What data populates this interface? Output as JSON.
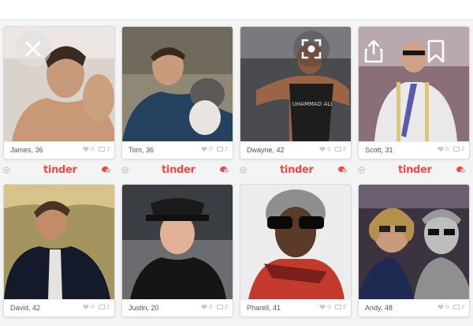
{
  "colors": {
    "brand": "#ee4a44",
    "muted": "#b5b5b5",
    "text": "#555555"
  },
  "brand_label": "tinder",
  "overlay_icons": [
    "close-icon",
    "scan-icon",
    "share-icon",
    "bookmark-icon"
  ],
  "row1": [
    {
      "name": "James, 36",
      "likes": "0",
      "photos": "2"
    },
    {
      "name": "Tom, 36",
      "likes": "0",
      "photos": "2"
    },
    {
      "name": "Dwayne, 42",
      "likes": "0",
      "photos": "2"
    },
    {
      "name": "Scott, 31",
      "likes": "0",
      "photos": "2"
    }
  ],
  "row2": [
    {
      "name": "David, 42",
      "likes": "0",
      "photos": "2"
    },
    {
      "name": "Justin, 20",
      "likes": "0",
      "photos": "2"
    },
    {
      "name": "Pharell, 41",
      "likes": "0",
      "photos": "2"
    },
    {
      "name": "Andy, 48",
      "likes": "0",
      "photos": "2"
    }
  ],
  "photo_texts": {
    "tank_top": "UHAMMAD ALI"
  }
}
